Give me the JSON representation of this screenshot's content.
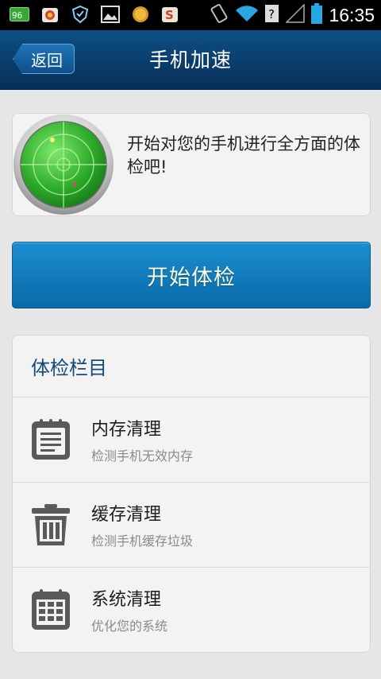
{
  "status_bar": {
    "time": "16:35",
    "icons": [
      "battery-level-icon",
      "app-icon",
      "shield-icon",
      "image-icon",
      "circle-app-icon",
      "s-app-icon",
      "vibrate-icon",
      "wifi-icon",
      "unknown-signal-icon",
      "signal-icon",
      "battery-icon"
    ]
  },
  "header": {
    "back_label": "返回",
    "title": "手机加速"
  },
  "intro": {
    "text": "开始对您的手机进行全方面的体检吧!"
  },
  "start_button": {
    "label": "开始体检"
  },
  "checklist": {
    "title": "体检栏目",
    "items": [
      {
        "title": "内存清理",
        "subtitle": "检测手机无效内存",
        "icon": "notepad-icon"
      },
      {
        "title": "缓存清理",
        "subtitle": "检测手机缓存垃圾",
        "icon": "trash-icon"
      },
      {
        "title": "系统清理",
        "subtitle": "优化您的系统",
        "icon": "calendar-grid-icon"
      }
    ]
  },
  "colors": {
    "titlebar": "#0a3d6b",
    "accent": "#0c78bb",
    "list_title": "#134a79"
  }
}
